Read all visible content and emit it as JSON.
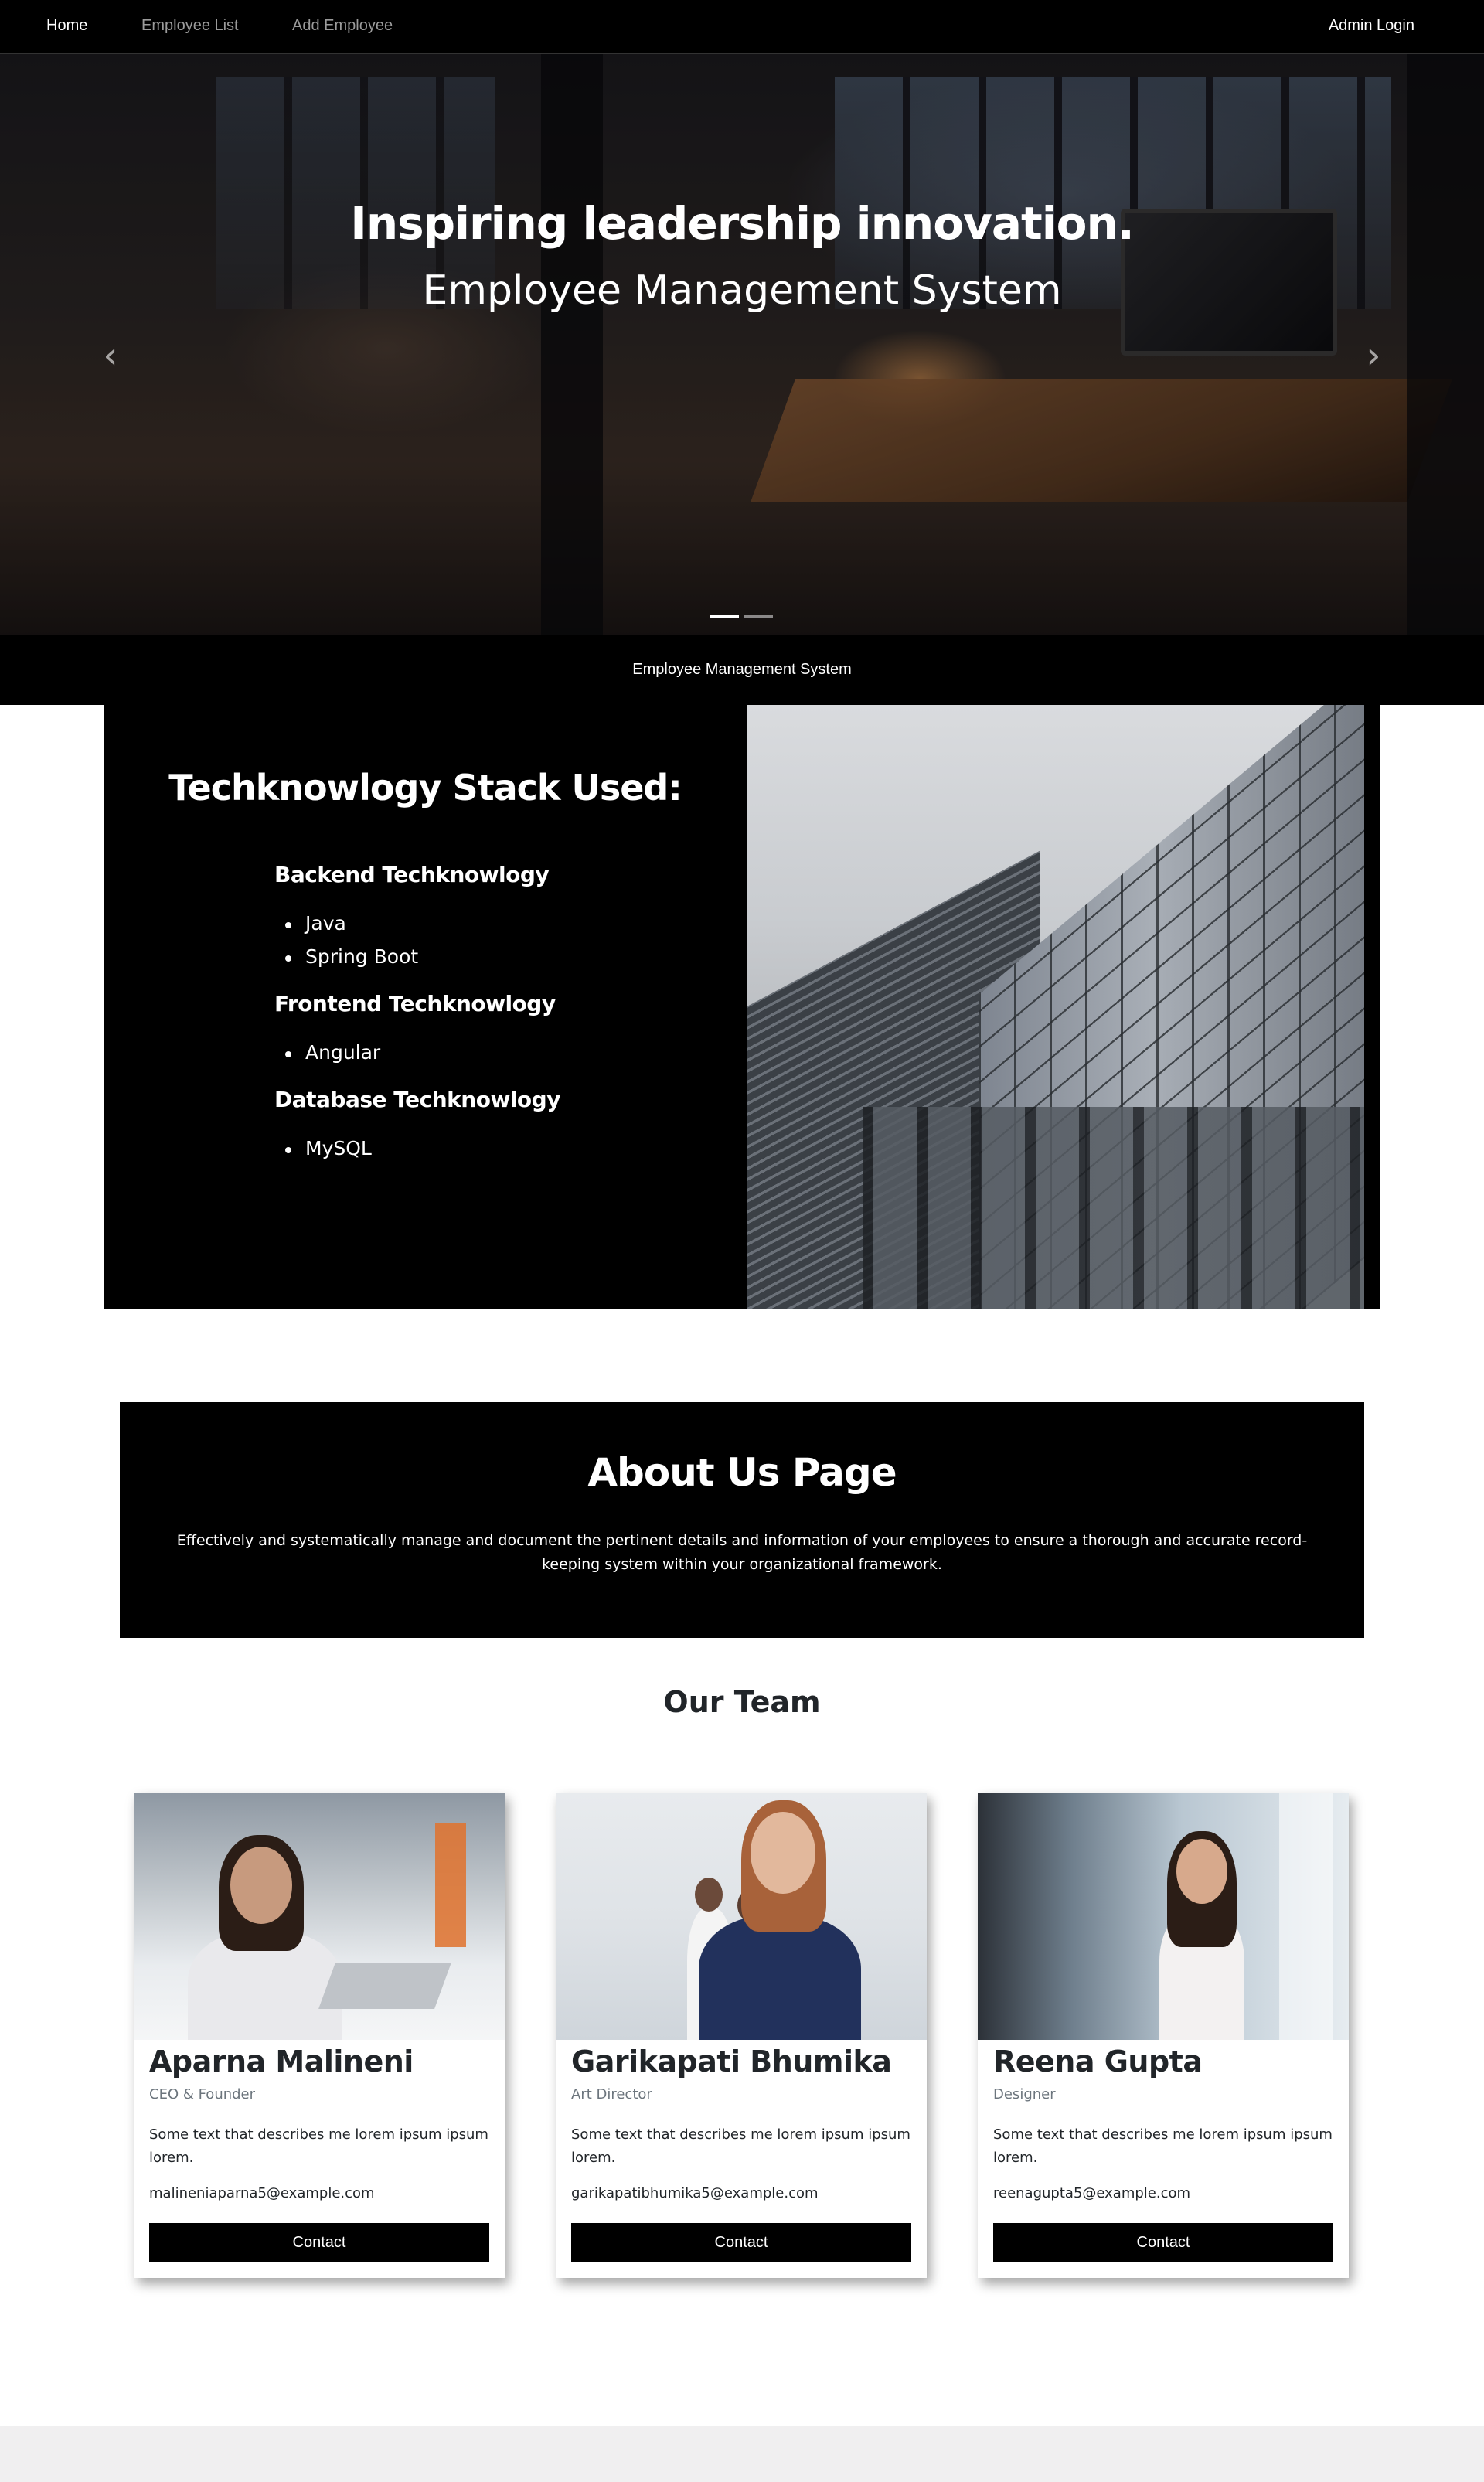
{
  "nav": {
    "home": "Home",
    "employee_list": "Employee List",
    "add_employee": "Add Employee",
    "admin_login": "Admin Login"
  },
  "hero": {
    "title": "Inspiring leadership innovation.",
    "subtitle": "Employee Management System",
    "prev_icon": "chevron-left-icon",
    "next_icon": "chevron-right-icon",
    "prev_glyph": "‹",
    "next_glyph": "›",
    "slides": 2,
    "active_slide": 1
  },
  "band": {
    "text": "Employee Management System"
  },
  "tech": {
    "heading": "Techknowlogy Stack Used:",
    "backend": {
      "title": "Backend Techknowlogy",
      "items": [
        "Java",
        "Spring Boot"
      ]
    },
    "frontend": {
      "title": "Frontend Techknowlogy",
      "items": [
        "Angular"
      ]
    },
    "database": {
      "title": "Database Techknowlogy",
      "items": [
        "MySQL"
      ]
    }
  },
  "about": {
    "title": "About Us Page",
    "text": "Effectively and systematically manage and document the pertinent details and information of your employees to ensure a thorough and accurate record-keeping system within your organizational framework."
  },
  "team": {
    "title": "Our Team",
    "members": [
      {
        "name": "Aparna Malineni",
        "role": "CEO & Founder",
        "description": "Some text that describes me lorem ipsum ipsum lorem.",
        "email": "malineniaparna5@example.com",
        "button": "Contact"
      },
      {
        "name": "Garikapati Bhumika",
        "role": "Art Director",
        "description": "Some text that describes me lorem ipsum ipsum lorem.",
        "email": "garikapatibhumika5@example.com",
        "button": "Contact"
      },
      {
        "name": "Reena Gupta",
        "role": "Designer",
        "description": "Some text that describes me lorem ipsum ipsum lorem.",
        "email": "reenagupta5@example.com",
        "button": "Contact"
      }
    ]
  },
  "colors": {
    "nav_bg": "#000000",
    "accent_button": "#000000",
    "muted_text": "#6c757d",
    "footer_bg": "#f0eff0"
  }
}
